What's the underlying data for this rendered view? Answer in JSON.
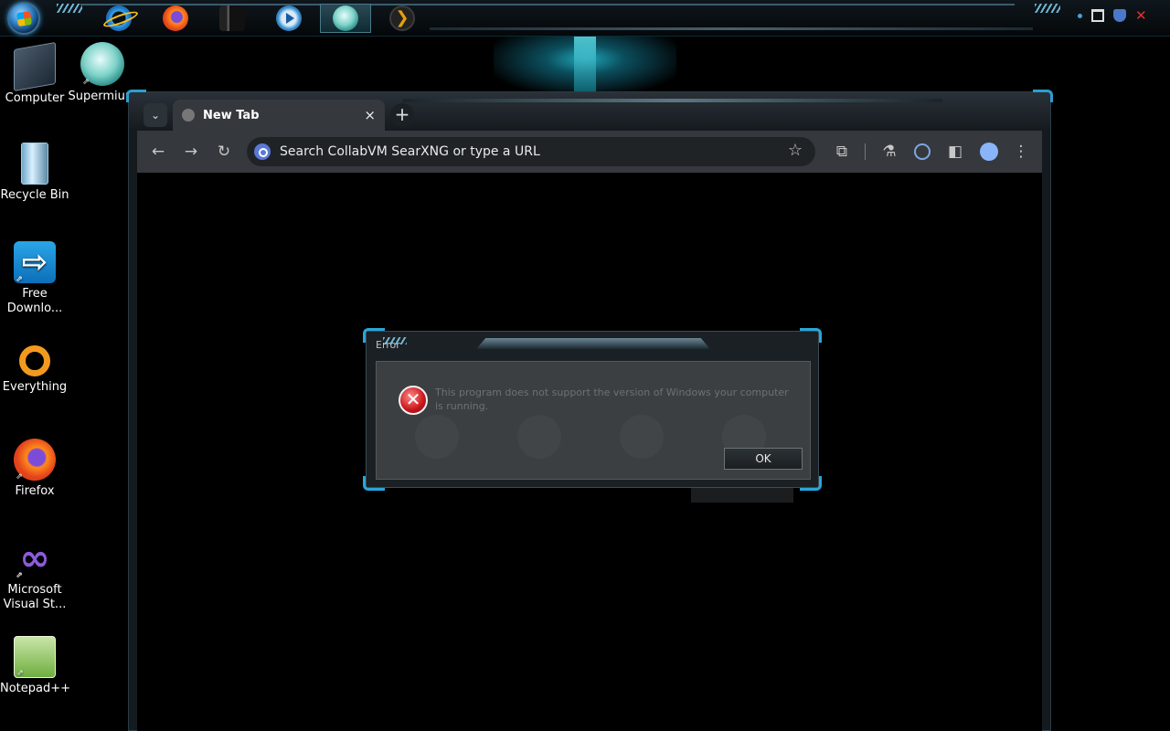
{
  "taskbar": {
    "start_icon": "windows-orb-icon",
    "pinned": [
      {
        "name": "internet-explorer-icon",
        "active": false
      },
      {
        "name": "firefox-icon",
        "active": false
      },
      {
        "name": "media-center-icon",
        "active": false
      },
      {
        "name": "media-player-icon",
        "active": false
      },
      {
        "name": "supermium-icon",
        "active": true
      },
      {
        "name": "plex-icon",
        "active": false
      }
    ],
    "tray": [
      "network-icon",
      "shield-icon",
      "red-x-icon"
    ]
  },
  "desktop_icons": [
    {
      "label": "Computer",
      "icon": "computer-icon"
    },
    {
      "label": "Supermium",
      "icon": "supermium-icon"
    },
    {
      "label": "Recycle Bin",
      "icon": "recycle-bin-icon"
    },
    {
      "label": "Free Downlo...",
      "icon": "free-download-manager-icon"
    },
    {
      "label": "Everything",
      "icon": "everything-search-icon"
    },
    {
      "label": "Firefox",
      "icon": "firefox-icon"
    },
    {
      "label": "Microsoft Visual St...",
      "icon": "visual-studio-icon"
    },
    {
      "label": "Notepad++",
      "icon": "notepad-plus-plus-icon"
    }
  ],
  "browser": {
    "tab_title": "New Tab",
    "tab_close": "×",
    "new_tab": "+",
    "tab_search": "⌄",
    "back": "←",
    "forward": "→",
    "reload": "↻",
    "omnibox_placeholder": "Search CollabVM SearXNG or type a URL",
    "star": "☆",
    "extensions": "⧉",
    "labs": "⚗",
    "sidepanel": "◧",
    "menu": "⋮"
  },
  "dialog": {
    "title": "Error",
    "icon": "error-x-icon",
    "message": "This program does not support the version of Windows your computer is running.",
    "ok_label": "OK"
  }
}
